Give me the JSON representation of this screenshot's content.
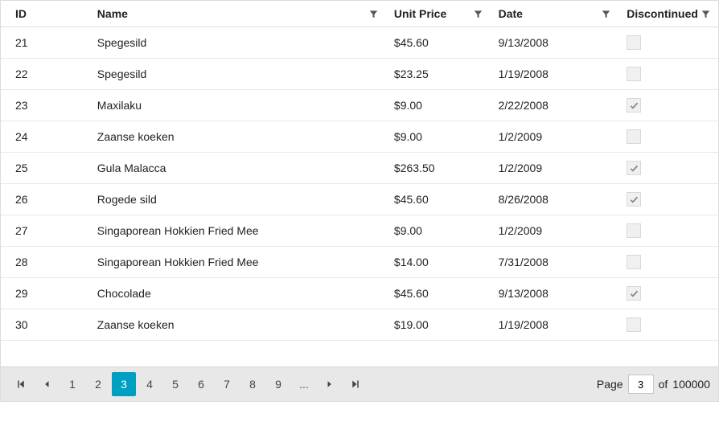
{
  "columns": {
    "id": "ID",
    "name": "Name",
    "price": "Unit Price",
    "date": "Date",
    "disc": "Discontinued"
  },
  "rows": [
    {
      "id": "21",
      "name": "Spegesild",
      "price": "$45.60",
      "date": "9/13/2008",
      "disc": false
    },
    {
      "id": "22",
      "name": "Spegesild",
      "price": "$23.25",
      "date": "1/19/2008",
      "disc": false
    },
    {
      "id": "23",
      "name": "Maxilaku",
      "price": "$9.00",
      "date": "2/22/2008",
      "disc": true
    },
    {
      "id": "24",
      "name": "Zaanse koeken",
      "price": "$9.00",
      "date": "1/2/2009",
      "disc": false
    },
    {
      "id": "25",
      "name": "Gula Malacca",
      "price": "$263.50",
      "date": "1/2/2009",
      "disc": true
    },
    {
      "id": "26",
      "name": "Rogede sild",
      "price": "$45.60",
      "date": "8/26/2008",
      "disc": true
    },
    {
      "id": "27",
      "name": "Singaporean Hokkien Fried Mee",
      "price": "$9.00",
      "date": "1/2/2009",
      "disc": false
    },
    {
      "id": "28",
      "name": "Singaporean Hokkien Fried Mee",
      "price": "$14.00",
      "date": "7/31/2008",
      "disc": false
    },
    {
      "id": "29",
      "name": "Chocolade",
      "price": "$45.60",
      "date": "9/13/2008",
      "disc": true
    },
    {
      "id": "30",
      "name": "Zaanse koeken",
      "price": "$19.00",
      "date": "1/19/2008",
      "disc": false
    }
  ],
  "pager": {
    "pages": [
      "1",
      "2",
      "3",
      "4",
      "5",
      "6",
      "7",
      "8",
      "9"
    ],
    "ellipsis": "...",
    "current": "3",
    "page_label": "Page",
    "of_label": "of",
    "total": "100000",
    "input_value": "3"
  }
}
